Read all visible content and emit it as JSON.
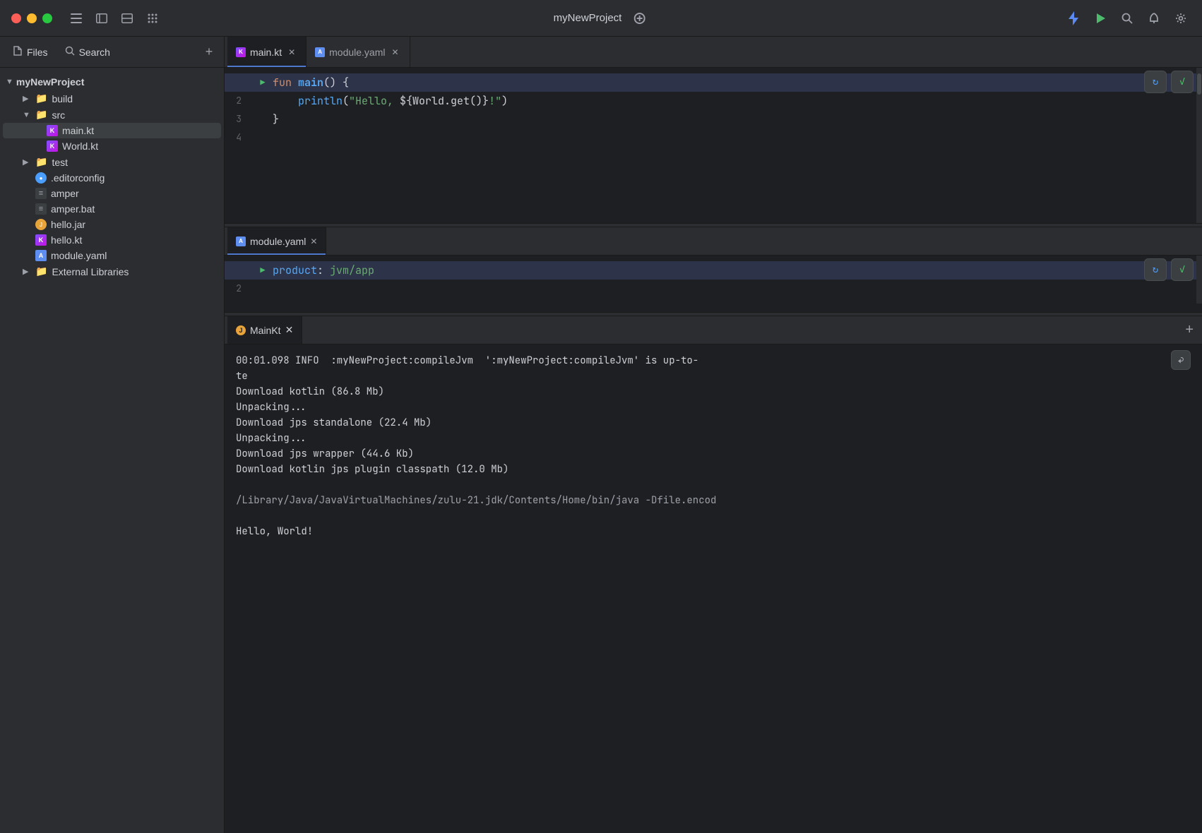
{
  "app": {
    "project_name": "myNewProject",
    "title": "myNewProject"
  },
  "titlebar": {
    "traffic_lights": [
      "close",
      "minimize",
      "maximize"
    ],
    "project_name": "myNewProject",
    "add_config_label": "+",
    "lightning_icon": "⚡",
    "run_icon": "▶",
    "search_icon": "🔍",
    "bell_icon": "🔔",
    "shield_icon": "🛡"
  },
  "sidebar": {
    "tabs": [
      {
        "label": "Files",
        "icon": "📁"
      },
      {
        "label": "Search",
        "icon": "🔍"
      }
    ],
    "add_icon": "+",
    "tree": {
      "root": "myNewProject",
      "items": [
        {
          "label": "build",
          "type": "folder",
          "indent": 1,
          "expanded": false
        },
        {
          "label": "src",
          "type": "folder",
          "indent": 1,
          "expanded": true
        },
        {
          "label": "main.kt",
          "type": "kotlin",
          "indent": 2,
          "selected": true
        },
        {
          "label": "World.kt",
          "type": "kotlin",
          "indent": 2
        },
        {
          "label": "test",
          "type": "folder",
          "indent": 1,
          "expanded": false
        },
        {
          "label": ".editorconfig",
          "type": "editorconfig",
          "indent": 1
        },
        {
          "label": "amper",
          "type": "amper",
          "indent": 1
        },
        {
          "label": "amper.bat",
          "type": "amper",
          "indent": 1
        },
        {
          "label": "hello.jar",
          "type": "jar",
          "indent": 1
        },
        {
          "label": "hello.kt",
          "type": "kotlin",
          "indent": 1
        },
        {
          "label": "module.yaml",
          "type": "yaml",
          "indent": 1
        },
        {
          "label": "External Libraries",
          "type": "folder",
          "indent": 1,
          "expanded": false
        }
      ]
    }
  },
  "editor": {
    "tabs": [
      {
        "label": "main.kt",
        "type": "kotlin",
        "active": true
      },
      {
        "label": "module.yaml",
        "type": "yaml",
        "active": false
      }
    ],
    "main_kt": {
      "lines": [
        {
          "num": "",
          "run": true,
          "content": "fun main() {",
          "highlighted": true
        },
        {
          "num": "2",
          "run": false,
          "content": "    println(\"Hello, ${World.get()}!\")",
          "highlighted": false
        },
        {
          "num": "3",
          "run": false,
          "content": "}",
          "highlighted": false
        },
        {
          "num": "4",
          "run": false,
          "content": "",
          "highlighted": false
        }
      ]
    },
    "module_yaml": {
      "section_label": "module.yaml",
      "lines": [
        {
          "num": "",
          "run": true,
          "content": "product: jvm/app",
          "highlighted": true
        },
        {
          "num": "2",
          "run": false,
          "content": "",
          "highlighted": false
        }
      ]
    }
  },
  "terminal": {
    "tab_label": "MainKt",
    "tab_icon": "J",
    "add_icon": "+",
    "lines": [
      {
        "text": "00:01.098 INFO  :myNewProject:compileJvm  ':myNewProject:compileJvm' is up-to-\nte",
        "type": "info"
      },
      {
        "text": "Download kotlin (86.8 Mb)",
        "type": "normal"
      },
      {
        "text": "Unpacking...",
        "type": "normal"
      },
      {
        "text": "Download jps standalone (22.4 Mb)",
        "type": "normal"
      },
      {
        "text": "Unpacking...",
        "type": "normal"
      },
      {
        "text": "Download jps wrapper (44.6 Kb)",
        "type": "normal"
      },
      {
        "text": "Download kotlin jps plugin classpath (12.0 Mb)",
        "type": "normal"
      },
      {
        "text": "",
        "type": "normal"
      },
      {
        "text": "/Library/Java/JavaVirtualMachines/zulu-21.jdk/Contents/Home/bin/java -Dfile.encod",
        "type": "command"
      },
      {
        "text": "",
        "type": "normal"
      },
      {
        "text": "Hello, World!",
        "type": "success"
      }
    ]
  },
  "buttons": {
    "refresh_label": "↻",
    "check_label": "✓",
    "undo_label": "↩"
  }
}
